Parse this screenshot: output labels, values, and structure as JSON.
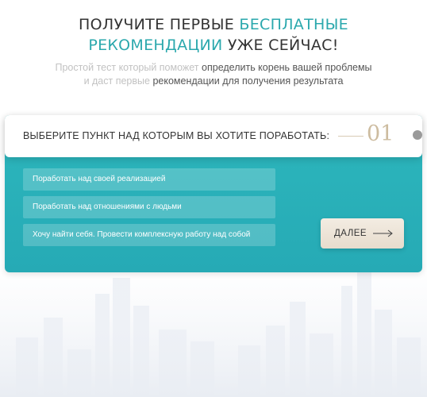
{
  "headline": {
    "part1": "ПОЛУЧИТЕ ПЕРВЫЕ ",
    "accent1": "БЕСПЛАТНЫЕ",
    "accent2": "РЕКОМЕНДАЦИИ",
    "part2": " УЖЕ СЕЙЧАС!"
  },
  "subtitle": {
    "line1_faded": "Простой тест который поможет ",
    "line1": "определить корень вашей проблемы",
    "line2_faded": "и даст первые ",
    "line2": "рекомендации для получения результата"
  },
  "question": {
    "text": "ВЫБЕРИТЕ ПУНКТ НАД КОТОРЫМ ВЫ ХОТИТЕ ПОРАБОТАТЬ:",
    "number": "01"
  },
  "options": [
    "Поработать над своей реализацией",
    "Поработать над отношениями с людьми",
    "Хочу найти себя. Провести комплексную работу над собой"
  ],
  "next_button": {
    "label": "ДАЛЕЕ",
    "icon": "arrow-right-icon"
  },
  "colors": {
    "accent": "#2ba8ad",
    "panel": "#2db7bd",
    "number": "#cdbca0",
    "button": "#efe6da"
  }
}
